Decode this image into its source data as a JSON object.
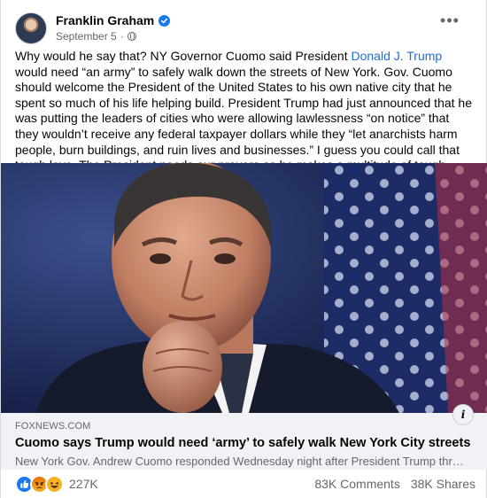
{
  "post": {
    "author": "Franklin Graham",
    "date": "September 5",
    "body_before_mention": "Why would he say that? NY Governor Cuomo said President ",
    "mention": "Donald J. Trump",
    "body_after_mention": " would need “an army” to safely walk down the streets of New York. Gov. Cuomo should welcome the President of the United States to his own native city that he spent so much of his life helping build. President Trump had just announced that he was putting the leaders of cities who were allowing lawlessness “on notice” that they wouldn’t receive any federal taxpayer dollars while they “let anarchists harm people, burn buildings, and ruin lives and businesses.” I guess you could call that tough love. The President needs our prayers as he makes a multitude of tough decisions like this—and pray for his protection."
  },
  "link": {
    "domain": "FOXNEWS.COM",
    "title": "Cuomo says Trump would need ‘army’ to safely walk New York City streets",
    "description": "New York Gov. Andrew Cuomo responded Wednesday night after President Trump threa…"
  },
  "engagement": {
    "reaction_count": "227K",
    "comments": "83K Comments",
    "shares": "38K Shares"
  },
  "icons": {
    "verified": "verified-badge-icon",
    "privacy": "globe-icon",
    "more": "more-options-icon",
    "info": "info-icon",
    "reactions": [
      "like-icon",
      "angry-icon",
      "haha-icon"
    ]
  },
  "colors": {
    "link_blue": "#216fdb",
    "facebook_blue": "#1877f2",
    "secondary_text": "#65676b",
    "link_preview_bg": "#f0f2f5"
  }
}
